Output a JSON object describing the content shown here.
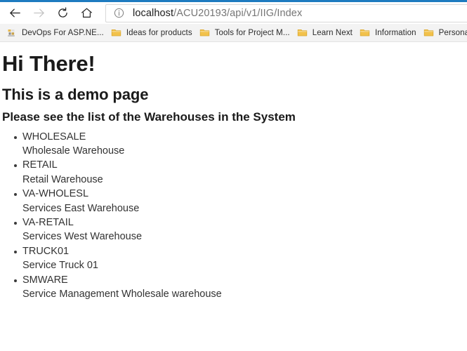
{
  "browser": {
    "accent_color": "#1e7bc0",
    "nav": {
      "back_label": "Back",
      "forward_label": "Forward",
      "refresh_label": "Refresh",
      "home_label": "Home"
    },
    "address_bar": {
      "info_icon": "info-icon",
      "host": "localhost",
      "path": "/ACU20193/api/v1/IIG/Index",
      "full_url": "localhost/ACU20193/api/v1/IIG/Index"
    },
    "bookmarks": [
      {
        "label": "DevOps For ASP.NE...",
        "icon": "site-favicon"
      },
      {
        "label": "Ideas for products",
        "icon": "folder-icon"
      },
      {
        "label": "Tools for Project M...",
        "icon": "folder-icon"
      },
      {
        "label": "Learn Next",
        "icon": "folder-icon"
      },
      {
        "label": "Information",
        "icon": "folder-icon"
      },
      {
        "label": "Personal",
        "icon": "folder-icon"
      }
    ]
  },
  "page": {
    "title": "Hi There!",
    "subtitle": "This is a demo page",
    "section_heading": "Please see the list of the Warehouses in the System",
    "warehouses": [
      {
        "code": "WHOLESALE",
        "description": "Wholesale Warehouse"
      },
      {
        "code": "RETAIL",
        "description": "Retail Warehouse"
      },
      {
        "code": "VA-WHOLESL",
        "description": "Services East Warehouse"
      },
      {
        "code": "VA-RETAIL",
        "description": "Services West Warehouse"
      },
      {
        "code": "TRUCK01",
        "description": "Service Truck 01"
      },
      {
        "code": "SMWARE",
        "description": "Service Management Wholesale warehouse"
      }
    ]
  }
}
